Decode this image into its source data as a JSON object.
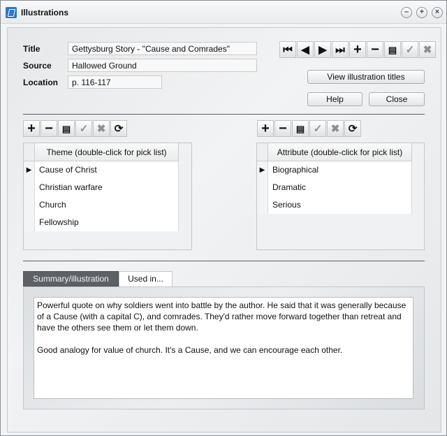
{
  "window": {
    "title": "Illustrations"
  },
  "form": {
    "title_label": "Title",
    "title_value": "Gettysburg Story - \"Cause and Comrades\"",
    "source_label": "Source",
    "source_value": "Hallowed Ground",
    "location_label": "Location",
    "location_value": "p. 116-117"
  },
  "buttons": {
    "view_titles": "View illustration titles",
    "help": "Help",
    "close": "Close"
  },
  "theme_grid": {
    "header": "Theme (double-click for pick list)",
    "rows": [
      "Cause of Christ",
      "Christian warfare",
      "Church",
      "Fellowship"
    ]
  },
  "attribute_grid": {
    "header": "Attribute (double-click for pick list)",
    "rows": [
      "Biographical",
      "Dramatic",
      "Serious"
    ]
  },
  "tabs": {
    "summary": "Summary/illustration",
    "used_in": "Used in..."
  },
  "summary_text": "Powerful quote on why soldiers went into battle by the author. He said that it was generally because of a Cause (with a capital C), and comrades. They'd rather move forward together than retreat and have the others see them or let them down.\n\nGood analogy for value of church. It's a Cause, and we can encourage each other.",
  "icons": {
    "nav": [
      "first-record-icon",
      "prev-record-icon",
      "next-record-icon",
      "last-record-icon",
      "add-icon",
      "delete-icon",
      "edit-icon",
      "post-icon",
      "cancel-icon"
    ],
    "grid": [
      "add-icon",
      "delete-icon",
      "edit-icon",
      "post-icon",
      "cancel-icon",
      "refresh-icon"
    ]
  }
}
